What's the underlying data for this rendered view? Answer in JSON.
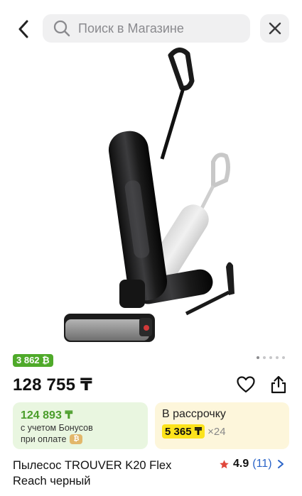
{
  "search": {
    "placeholder": "Поиск в Магазине"
  },
  "icons": {
    "back": "chevron-left-icon",
    "search": "search-icon",
    "close": "close-icon",
    "favorite": "heart-icon",
    "share": "share-icon",
    "rating": "star-icon",
    "rating_more": "chevron-right-icon",
    "bonus_coin": "coin-icon"
  },
  "gallery": {
    "image_count": 5,
    "active_index": 0
  },
  "product": {
    "bonus_badge": "3 862 ₿",
    "price": "128 755 ₸",
    "title": "Пылесос TROUVER K20 Flex Reach черный",
    "rating": {
      "value": "4.9",
      "count": "(11)"
    }
  },
  "bonus_card": {
    "price": "124 893 ₸",
    "line1": "с учетом Бонусов",
    "line2": "при оплате",
    "coin_symbol": "₿"
  },
  "installment_card": {
    "label": "В рассрочку",
    "amount": "5 365 ₸",
    "multiplier": "×24"
  },
  "colors": {
    "bonus_green": "#4faa2a",
    "bonus_card_bg": "#e9f6e0",
    "installment_bg": "#fdf6db",
    "installment_highlight": "#fce31c",
    "rating_link": "#2a64c8",
    "star": "#e0463a"
  }
}
